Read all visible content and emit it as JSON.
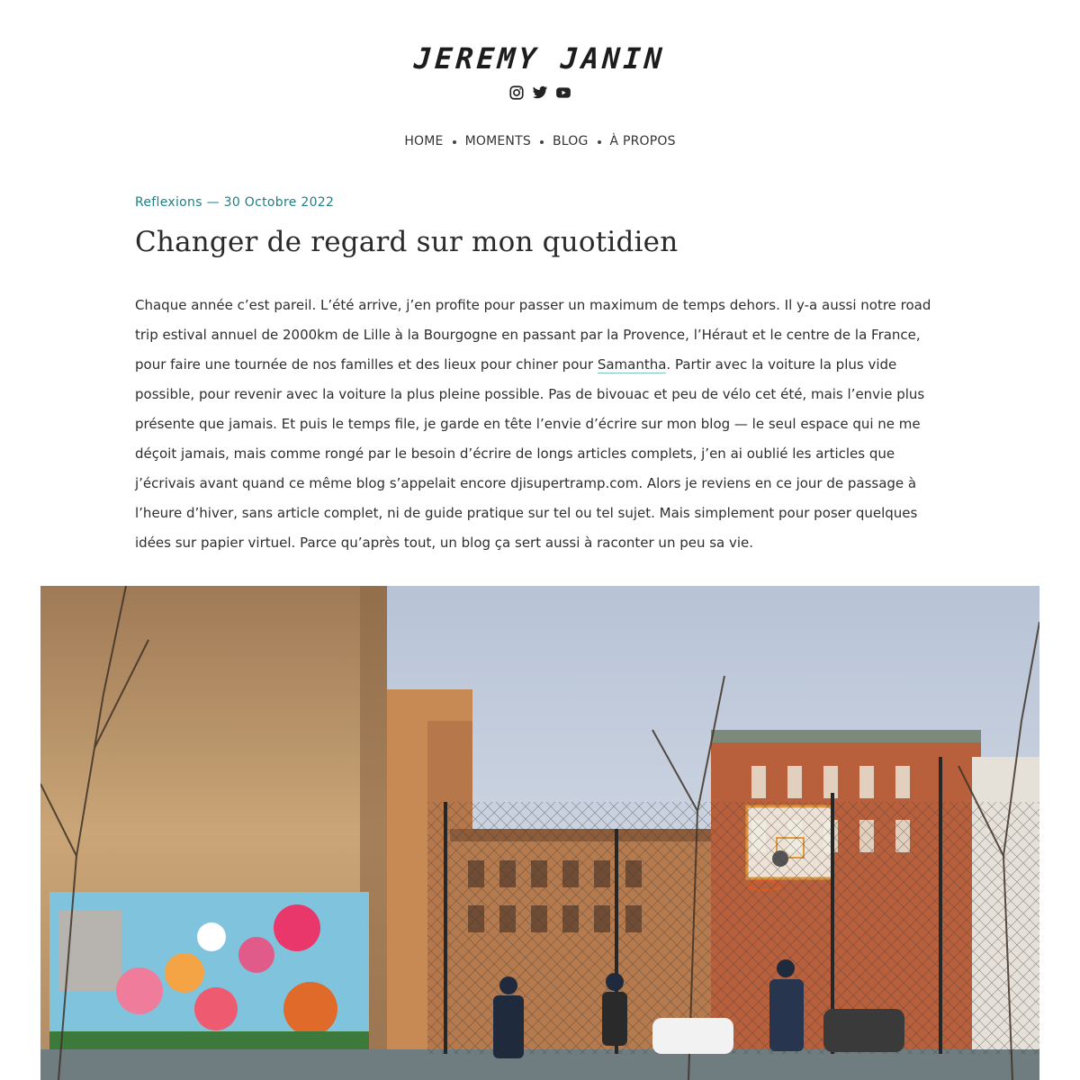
{
  "site": {
    "title": "JEREMY JANIN",
    "socials": [
      {
        "icon": "instagram-icon"
      },
      {
        "icon": "twitter-icon"
      },
      {
        "icon": "youtube-icon"
      }
    ]
  },
  "nav": {
    "items": [
      {
        "label": "HOME"
      },
      {
        "label": "MOMENTS"
      },
      {
        "label": "BLOG"
      },
      {
        "label": "À PROPOS"
      }
    ]
  },
  "post": {
    "category": "Reflexions",
    "separator": "—",
    "date": "30 Octobre 2022",
    "title": "Changer de regard sur mon quotidien",
    "body_before_link": "Chaque année c’est pareil. L’été arrive, j’en profite pour passer un maximum de temps dehors. Il y-a aussi notre road trip estival annuel de 2000km de Lille à la Bourgogne en passant par la Provence, l’Héraut et le centre de la France, pour faire une tournée de nos familles et des lieux pour chiner pour ",
    "link_text": "Samantha",
    "body_after_link": ". Partir avec la voiture la plus vide possible, pour revenir avec la voiture la plus pleine possible. Pas de bivouac et peu de vélo cet été, mais l’envie plus présente que jamais. Et puis le temps file, je garde en tête l’envie d’écrire sur mon blog — le seul espace qui ne me déçoit jamais, mais comme rongé par le besoin d’écrire de longs articles complets, j’en ai oublié les articles que j’écrivais avant quand ce même blog s’appelait encore djisupertramp.com. Alors je reviens en ce jour de passage à l’heure d’hiver, sans article complet, ni de guide pratique sur tel ou tel sujet. Mais simplement pour poser quelques idées sur papier virtuel. Parce qu’après tout, un blog ça sert aussi à raconter un peu sa vie."
  },
  "colors": {
    "accent": "#1e7f85",
    "link_underline": "#7cc7b9"
  }
}
